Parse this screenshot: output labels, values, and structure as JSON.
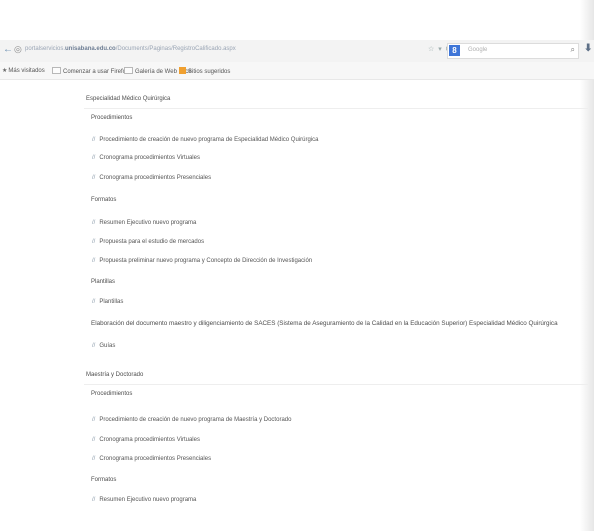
{
  "browser": {
    "url_prefix": "portalservicios.",
    "url_domain": "unisabana.edu.co",
    "url_path": "/Documents/Paginas/RegistroCalificado.aspx",
    "url_controls": "☆ ▾ C",
    "search_placeholder": "Google",
    "google_letter": "8"
  },
  "bookmarks": [
    {
      "label": "Más visitados"
    },
    {
      "label": "Comenzar a usar Firefox"
    },
    {
      "label": "Galería de Web Slice"
    },
    {
      "label": "Sitios sugeridos"
    }
  ],
  "sections": {
    "esp_title": "Especialidad Médico Quirúrgica",
    "esp_proc": "Procedimientos",
    "esp_proc_items": [
      "Procedimiento de creación de nuevo programa de Especialidad Médico Quirúrgica",
      "Cronograma procedimientos Virtuales",
      "Cronograma procedimientos Presenciales"
    ],
    "esp_formatos": "Formatos",
    "esp_formatos_items": [
      "Resumen Ejecutivo nuevo programa",
      "Propuesta para el estudio de mercados",
      "Propuesta preliminar nuevo programa y Concepto de Dirección de Investigación"
    ],
    "esp_plantillas": "Plantillas",
    "esp_plantillas_items": [
      "Plantillas"
    ],
    "esp_elaboracion": "Elaboración del documento maestro y diligenciamiento de SACES (Sistema de Aseguramiento de la Calidad en la Educación Superior) Especialidad Médico Quirúrgica",
    "esp_guias_items": [
      "Guías"
    ],
    "mae_title": "Maestría y Doctorado",
    "mae_proc": "Procedimientos",
    "mae_proc_items": [
      "Procedimiento de creación de nuevo programa de Maestría y Doctorado",
      "Cronograma procedimientos Virtuales",
      "Cronograma procedimientos Presenciales"
    ],
    "mae_formatos": "Formatos",
    "mae_formatos_items": [
      "Resumen Ejecutivo nuevo programa"
    ]
  }
}
